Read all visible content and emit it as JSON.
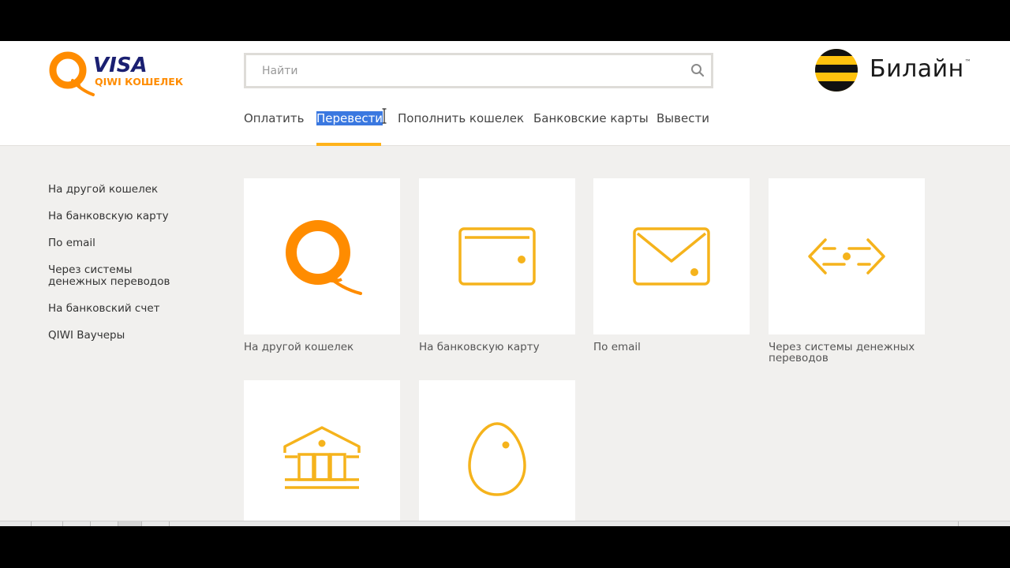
{
  "header": {
    "qiwi_logo": {
      "brand": "VISA",
      "tagline": "QIWI КОШЕЛЕК",
      "accent": "#ff8c00",
      "brand_color": "#1a1f71"
    },
    "search": {
      "placeholder": "Найти",
      "icon": "search-icon"
    },
    "partner_logo": {
      "text": "Билайн",
      "tm": "™",
      "stripe_yellow": "#ffc20e",
      "stripe_black": "#000000"
    }
  },
  "nav": {
    "items": [
      {
        "label": "Оплатить"
      },
      {
        "label": "Перевести",
        "active": true
      },
      {
        "label": "Пополнить кошелек"
      },
      {
        "label": "Банковские карты"
      },
      {
        "label": "Вывести"
      }
    ],
    "active_color": "#ffb31a",
    "selection_color": "#3a78e0"
  },
  "sidebar": {
    "items": [
      {
        "label": "На другой кошелек"
      },
      {
        "label": "На банковскую карту"
      },
      {
        "label": "По email"
      },
      {
        "label": "Через системы денежных переводов"
      },
      {
        "label": "На банковский счет"
      },
      {
        "label": "QIWI Ваучеры"
      }
    ]
  },
  "tiles": [
    {
      "label": "На другой кошелек",
      "icon": "qiwi-logo-icon"
    },
    {
      "label": "На банковскую карту",
      "icon": "card-icon"
    },
    {
      "label": "По email",
      "icon": "envelope-icon"
    },
    {
      "label": "Через системы денежных переводов",
      "icon": "transfer-arrows-icon"
    },
    {
      "label": "",
      "icon": "bank-icon"
    },
    {
      "label": "",
      "icon": "egg-icon"
    }
  ],
  "colors": {
    "icon_stroke": "#f5b31c",
    "qiwi_orange": "#ff8c00",
    "page_bg": "#f1f0ee"
  }
}
